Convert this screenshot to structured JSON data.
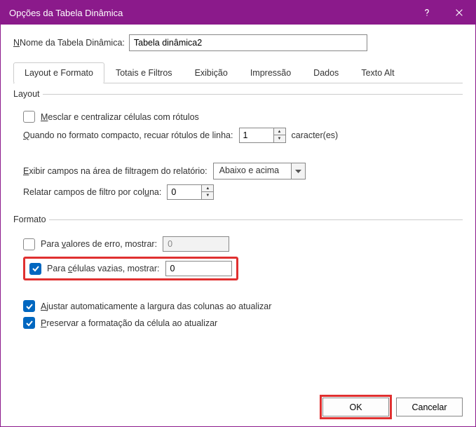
{
  "titlebar": {
    "title": "Opções da Tabela Dinâmica"
  },
  "name_row": {
    "label": "Nome da Tabela Dinâmica:",
    "value": "Tabela dinâmica2"
  },
  "tabs": {
    "items": [
      {
        "label": "Layout e Formato"
      },
      {
        "label": "Totais e Filtros"
      },
      {
        "label": "Exibição"
      },
      {
        "label": "Impressão"
      },
      {
        "label": "Dados"
      },
      {
        "label": "Texto Alt"
      }
    ]
  },
  "layout": {
    "legend": "Layout",
    "merge_label": "Mesclar e centralizar células com rótulos",
    "merge_underline": "M",
    "indent_label_pre": "Quando no formato compacto, recuar rótulos de linha:",
    "indent_underline": "Q",
    "indent_value": "1",
    "indent_suffix": "caracter(es)",
    "filter_pos_label": "Exibir campos na área de filtragem do relatório:",
    "filter_pos_underline": "E",
    "filter_pos_value": "Abaixo e acima",
    "filter_per_col_label": "Relatar campos de filtro por coluna:",
    "filter_per_col_underline": "u",
    "filter_per_col_value": "0"
  },
  "format": {
    "legend": "Formato",
    "error_label": "Para valores de erro, mostrar:",
    "error_underline": "v",
    "error_value": "0",
    "empty_label": "Para células vazias, mostrar:",
    "empty_underline": "c",
    "empty_value": "0",
    "autofit_label": "Ajustar automaticamente a largura das colunas ao atualizar",
    "autofit_underline": "A",
    "preserve_label": "Preservar a formatação da célula ao atualizar",
    "preserve_underline": "P"
  },
  "footer": {
    "ok": "OK",
    "cancel": "Cancelar"
  }
}
